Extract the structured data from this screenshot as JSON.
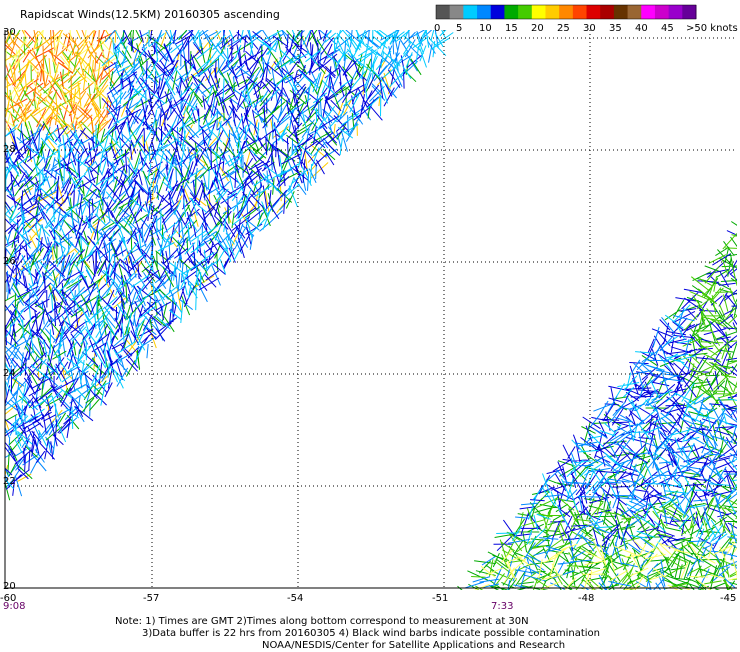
{
  "title": "Rapidscat Winds(12.5KM) 20160305 ascending",
  "legend": {
    "labels": [
      "0",
      "5",
      "10",
      "15",
      "20",
      "25",
      "30",
      "35",
      "40",
      "45",
      ">50 knots"
    ],
    "colors": [
      "#555555",
      "#888888",
      "#00ccff",
      "#0088ff",
      "#0000dd",
      "#00aa00",
      "#44cc00",
      "#ffff00",
      "#ffcc00",
      "#ff8800",
      "#ff4400",
      "#dd0000",
      "#aa0000",
      "#663300",
      "#996633",
      "#ff00ff",
      "#cc00cc",
      "#9900cc",
      "#660099"
    ]
  },
  "axes": {
    "lon_labels": [
      "-60",
      "-57",
      "-54",
      "-51",
      "-48",
      "-45"
    ],
    "lat_labels": [
      "30",
      "28",
      "26",
      "24",
      "22",
      "20"
    ]
  },
  "times": [
    "9:08",
    "7:33"
  ],
  "notes": {
    "line1": "Note: 1) Times are GMT 2)Times along bottom correspond to measurement at 30N",
    "line2": "3)Data buffer is 22 hrs from 20160305 4) Black wind barbs indicate possible contamination",
    "line3": "NOAA/NESDIS/Center for Satellite Applications and Research"
  }
}
